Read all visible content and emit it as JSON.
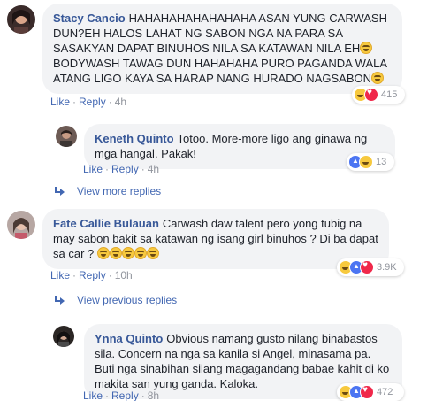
{
  "comments": [
    {
      "author": "Stacy Cancio",
      "text_1": "HAHAHAHAHAHAHAHA ASAN YUNG CARWASH DUN?EH HALOS LAHAT NG SABON NGA NA PARA SA SASAKYAN DAPAT BINUHOS NILA SA KATAWAN NILA EH",
      "text_2": "BODYWASH TAWAG DUN HAHAHAHA PURO PAGANDA WALA ATANG LIGO KAYA SA HARAP NANG HURADO NAGSABON",
      "like_label": "Like",
      "reply_label": "Reply",
      "time": "4h",
      "reaction_count": "415"
    },
    {
      "author": "Keneth Quinto",
      "text": "Totoo. More-more ligo ang ginawa ng mga hangal. Pakak!",
      "like_label": "Like",
      "reply_label": "Reply",
      "time": "4h",
      "reaction_count": "13"
    },
    {
      "author": "Fate Callie Bulauan",
      "text": "Carwash daw talent pero yong tubig na may sabon bakit sa katawan ng isang girl binuhos ? Di ba dapat sa car ?",
      "like_label": "Like",
      "reply_label": "Reply",
      "time": "10h",
      "reaction_count": "3.9K"
    },
    {
      "author": "Ynna Quinto",
      "text": "Obvious namang gusto nilang binabastos sila. Concern na nga sa kanila si Angel, minasama pa. Buti nga sinabihan silang magagandang babae kahit di ko makita san yung ganda. Kaloka.",
      "like_label": "Like",
      "reply_label": "Reply",
      "time": "8h",
      "reaction_count": "472"
    }
  ],
  "view_more_replies": "View more replies",
  "view_previous_replies": "View previous replies",
  "separator": "·",
  "colors": {
    "link": "#4267b2",
    "author": "#385898",
    "bubble": "#f2f3f5",
    "meta": "#90949c"
  }
}
